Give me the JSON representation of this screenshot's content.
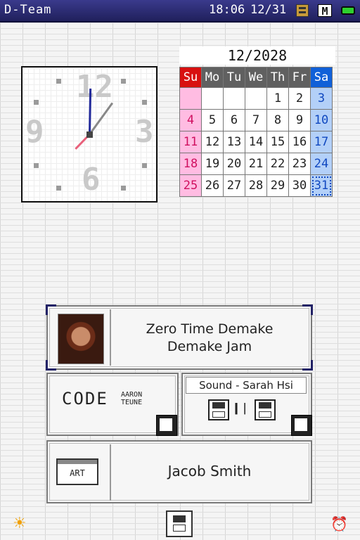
{
  "topbar": {
    "user": "D-Team",
    "time": "18:06",
    "date": "12/31",
    "icons": [
      "game-card-icon",
      "memory-icon",
      "battery-icon"
    ],
    "memory_letter": "M"
  },
  "clock": {
    "numerals": [
      "12",
      "3",
      "6",
      "9"
    ],
    "time": "18:06"
  },
  "calendar": {
    "title": "12/2028",
    "days": [
      "Su",
      "Mo",
      "Tu",
      "We",
      "Th",
      "Fr",
      "Sa"
    ],
    "weeks": [
      [
        "",
        "",
        "",
        "",
        "1",
        "2",
        "3"
      ],
      [
        "4",
        "5",
        "6",
        "7",
        "8",
        "9",
        "10"
      ],
      [
        "11",
        "12",
        "13",
        "14",
        "15",
        "16",
        "17"
      ],
      [
        "18",
        "19",
        "20",
        "21",
        "22",
        "23",
        "24"
      ],
      [
        "25",
        "26",
        "27",
        "28",
        "29",
        "30",
        "31"
      ]
    ],
    "today": "31"
  },
  "credits": {
    "title_line1": "Zero Time Demake",
    "title_line2": "Demake Jam",
    "code_label": "CODE",
    "code_author_1": "AARON",
    "code_author_2": "TEUNE",
    "sound_label": "Sound - Sarah Hsi",
    "art_badge": "ART",
    "art_author": "Jacob Smith"
  },
  "bottombar": {
    "icons": [
      "brightness-icon",
      "ds-download-icon",
      "alarm-clock-icon"
    ]
  }
}
